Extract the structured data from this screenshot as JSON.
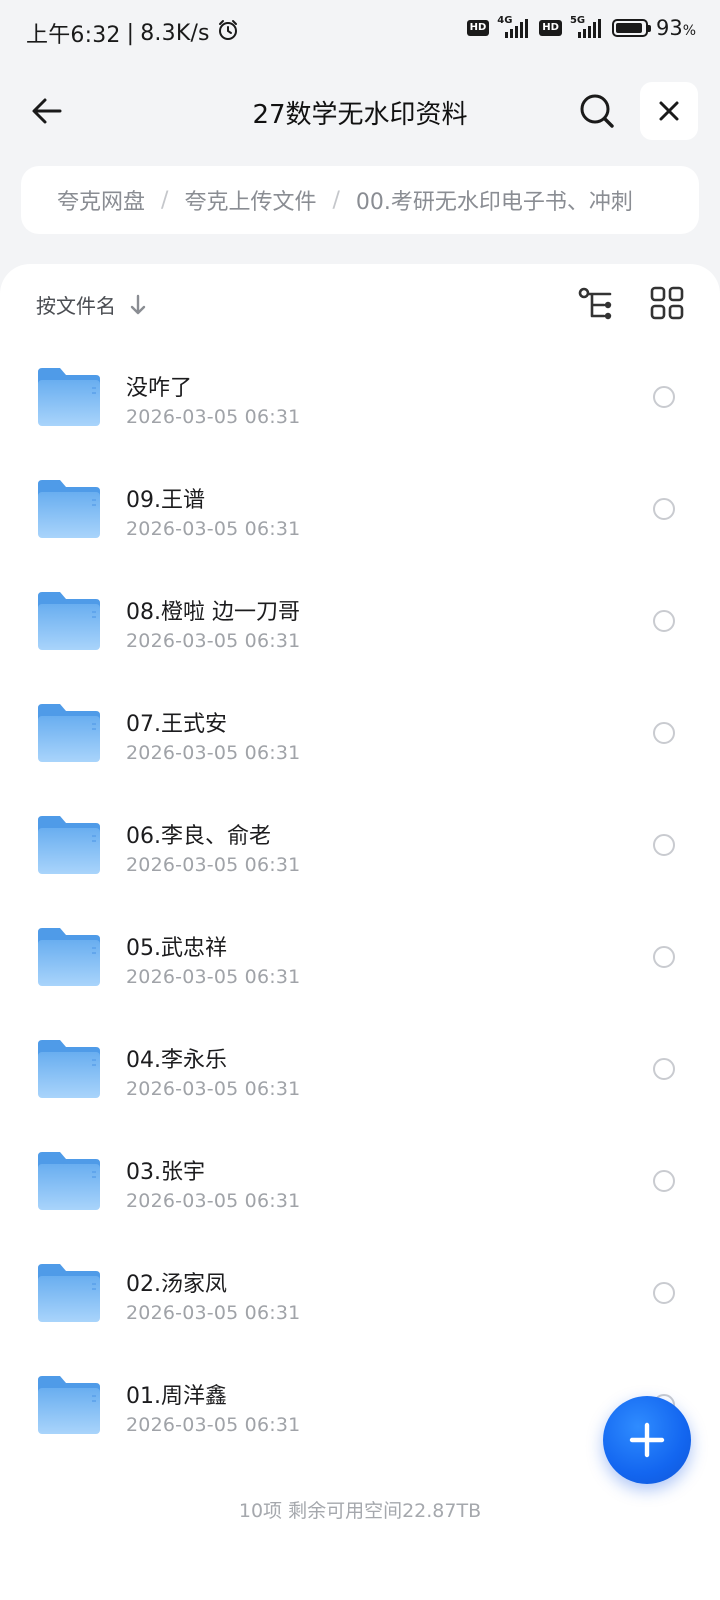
{
  "status_bar": {
    "time": "上午6:32",
    "divider": "|",
    "net_speed": "8.3K/s",
    "alarm_icon": "alarm-clock-icon",
    "sim1_hd": "HD",
    "sim1_network": "4G",
    "sim2_hd": "HD",
    "sim2_network": "5G",
    "battery_percent": 93,
    "battery_label": "93",
    "battery_unit": "%"
  },
  "top_bar": {
    "back_icon": "arrow-left-icon",
    "title": "27数学无水印资料",
    "search_icon": "search-icon",
    "close_icon": "close-icon"
  },
  "breadcrumb": {
    "items": [
      "夸克网盘",
      "夸克上传文件",
      "00.考研无水印电子书、冲刺"
    ],
    "separator": "/"
  },
  "sort_bar": {
    "label": "按文件名",
    "direction_icon": "arrow-down-icon",
    "tree_icon": "tree-view-icon",
    "grid_icon": "grid-view-icon"
  },
  "files": [
    {
      "name": "没咋了",
      "date": "2026-03-05 06:31"
    },
    {
      "name": "09.王谱",
      "date": "2026-03-05 06:31"
    },
    {
      "name": "08.橙啦 边一刀哥",
      "date": "2026-03-05 06:31"
    },
    {
      "name": "07.王式安",
      "date": "2026-03-05 06:31"
    },
    {
      "name": "06.李良、俞老",
      "date": "2026-03-05 06:31"
    },
    {
      "name": "05.武忠祥",
      "date": "2026-03-05 06:31"
    },
    {
      "name": "04.李永乐",
      "date": "2026-03-05 06:31"
    },
    {
      "name": "03.张宇",
      "date": "2026-03-05 06:31"
    },
    {
      "name": "02.汤家凤",
      "date": "2026-03-05 06:31"
    },
    {
      "name": "01.周洋鑫",
      "date": "2026-03-05 06:31"
    }
  ],
  "footer": {
    "summary": "10项 剩余可用空间22.87TB"
  },
  "fab": {
    "icon": "plus-icon"
  },
  "colors": {
    "accent": "#1366f0",
    "folder": "#8cc4f7",
    "background": "#f3f4f6"
  }
}
